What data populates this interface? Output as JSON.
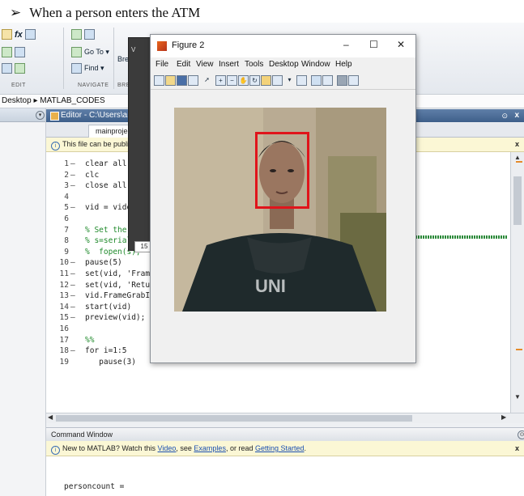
{
  "caption": {
    "arrow": "➢",
    "text": "When a person enters the ATM"
  },
  "ribbon": {
    "goto_label": "Go To ▾",
    "find_label": "Find ▾",
    "br_label": "Bre",
    "edit_label": "EDIT",
    "navigate_label": "NAVIGATE",
    "break_label": "BREA"
  },
  "address": {
    "text": "Desktop ▸ MATLAB_CODES"
  },
  "editor": {
    "title": "Editor - C:\\Users\\anura",
    "tab_label": "mainproject.m",
    "info_text": "This file can be publish",
    "lines": [
      {
        "n": "1",
        "d": "–",
        "code": "clear all",
        "cls": ""
      },
      {
        "n": "2",
        "d": "–",
        "code": "clc",
        "cls": ""
      },
      {
        "n": "3",
        "d": "–",
        "code": "close all",
        "cls": ""
      },
      {
        "n": "4",
        "d": "",
        "code": "",
        "cls": ""
      },
      {
        "n": "5",
        "d": "–",
        "code": "vid = vide",
        "cls": ""
      },
      {
        "n": "6",
        "d": "",
        "code": "",
        "cls": ""
      },
      {
        "n": "7",
        "d": "",
        "code": "% Set the",
        "cls": "cm"
      },
      {
        "n": "8",
        "d": "",
        "code": "% s=serial('COM",
        "cls": "cm"
      },
      {
        "n": "9",
        "d": "",
        "code": "%  fopen(s);",
        "cls": "cm"
      },
      {
        "n": "10",
        "d": "–",
        "code": "pause(5)",
        "cls": ""
      },
      {
        "n": "11",
        "d": "–",
        "code": "set(vid, 'Frame",
        "cls": ""
      },
      {
        "n": "12",
        "d": "–",
        "code": "set(vid, 'Retu",
        "cls": ""
      },
      {
        "n": "13",
        "d": "–",
        "code": "vid.FrameGrabIn",
        "cls": ""
      },
      {
        "n": "14",
        "d": "–",
        "code": "start(vid)",
        "cls": ""
      },
      {
        "n": "15",
        "d": "–",
        "code": "preview(vid);",
        "cls": ""
      },
      {
        "n": "16",
        "d": "",
        "code": "",
        "cls": ""
      },
      {
        "n": "17",
        "d": "",
        "code": "%%",
        "cls": "cm"
      },
      {
        "n": "18",
        "d": "–",
        "code": "for i=1:5",
        "cls": ""
      },
      {
        "n": "19",
        "d": "",
        "code": "   pause(3)",
        "cls": ""
      }
    ]
  },
  "popup_number": "15",
  "dark_window_label": "V",
  "command_window": {
    "title": "Command Window",
    "info_prefix": "New to MATLAB? Watch this ",
    "video_link": "Video",
    "see_text": ", see ",
    "examples_link": "Examples",
    "or_read_text": ", or read ",
    "getting_started_link": "Getting Started",
    "period": ".",
    "output_text": "personcount ="
  },
  "figure": {
    "title": "Figure 2",
    "minimize": "–",
    "maximize": "☐",
    "close": "✕",
    "menu": [
      "File",
      "Edit",
      "View",
      "Insert",
      "Tools",
      "Desktop",
      "Window",
      "Help"
    ],
    "shirt_text": "UNI"
  }
}
